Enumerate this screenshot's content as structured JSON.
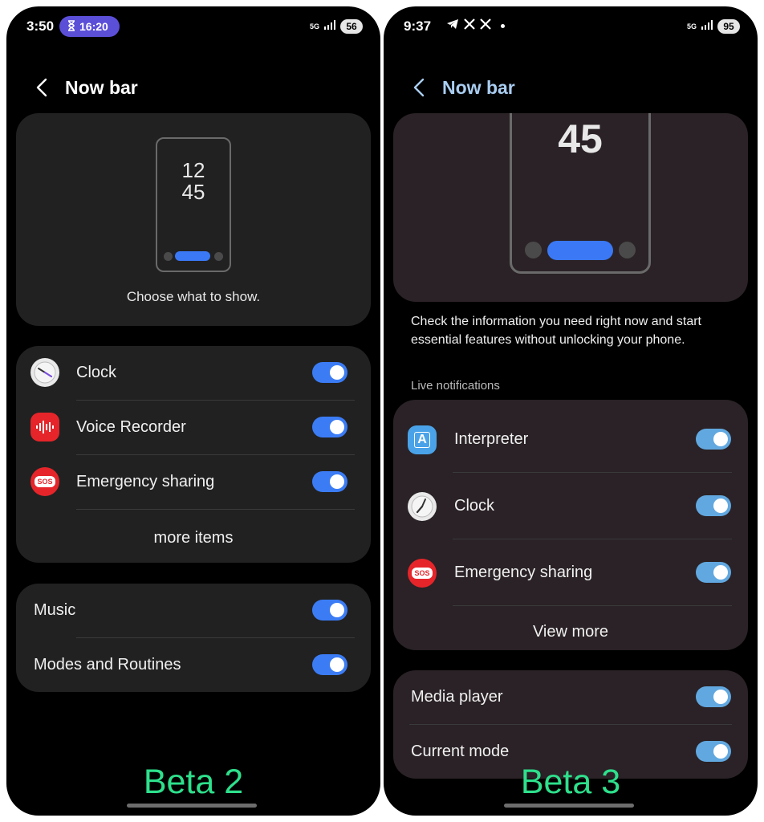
{
  "left": {
    "status": {
      "time": "3:50",
      "timer": "16:20",
      "network": "5G",
      "battery": "56"
    },
    "title": "Now bar",
    "preview": {
      "hour": "12",
      "minute": "45",
      "caption": "Choose what to show."
    },
    "items": [
      {
        "label": "Clock",
        "icon": "clock-icon",
        "on": true
      },
      {
        "label": "Voice Recorder",
        "icon": "voice-recorder-icon",
        "on": true
      },
      {
        "label": "Emergency sharing",
        "icon": "sos-icon",
        "on": true
      }
    ],
    "more_label": "more items",
    "sos_text": "SOS",
    "extras": [
      {
        "label": "Music",
        "on": true
      },
      {
        "label": "Modes and Routines",
        "on": true
      }
    ],
    "beta": "Beta 2"
  },
  "right": {
    "status": {
      "time": "9:37",
      "network": "5G",
      "battery": "95"
    },
    "title": "Now bar",
    "preview": {
      "minute": "45"
    },
    "description": "Check the information you need right now and start essential features without unlocking your phone.",
    "section_label": "Live notifications",
    "items": [
      {
        "label": "Interpreter",
        "icon": "interpreter-icon",
        "on": true
      },
      {
        "label": "Clock",
        "icon": "clock-icon",
        "on": true
      },
      {
        "label": "Emergency sharing",
        "icon": "sos-icon",
        "on": true
      }
    ],
    "more_label": "View more",
    "sos_text": "SOS",
    "interpreter_glyph": "A",
    "extras": [
      {
        "label": "Media player",
        "on": true
      },
      {
        "label": "Current mode",
        "on": true
      }
    ],
    "beta": "Beta 3"
  },
  "colors": {
    "toggle_blue": "#3b7cf5",
    "toggle_teal": "#62a8e0",
    "beta_green": "#2ee08c",
    "title_right": "#a9cdf1",
    "timer_pill": "#5b4fd8"
  }
}
